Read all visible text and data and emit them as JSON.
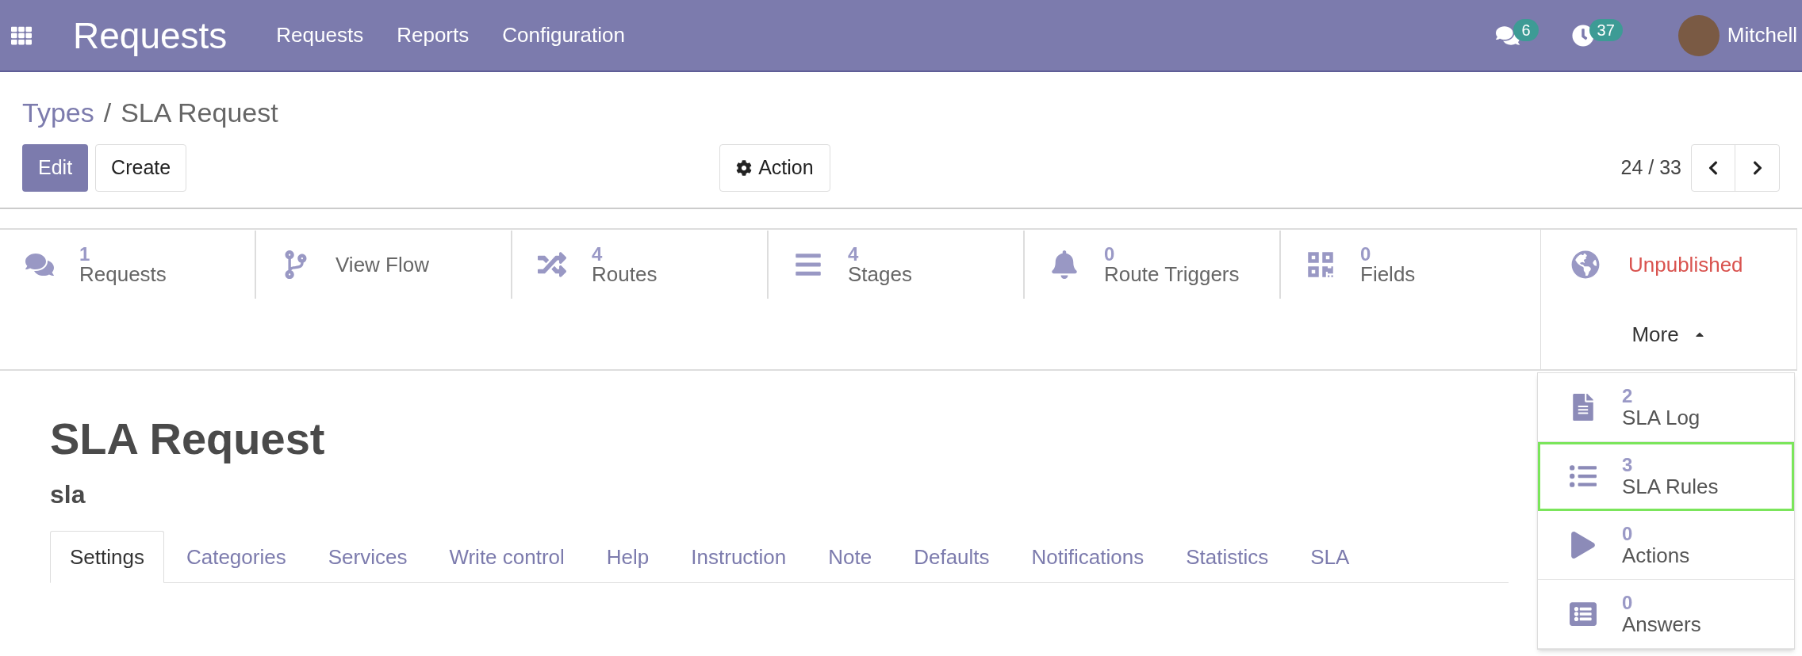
{
  "navbar": {
    "app_title": "Requests",
    "menu": [
      "Requests",
      "Reports",
      "Configuration"
    ],
    "messages_count": "6",
    "activities_count": "37",
    "user_name": "Mitchell"
  },
  "breadcrumb": {
    "parent": "Types",
    "separator": "/",
    "current": "SLA Request"
  },
  "buttons": {
    "edit": "Edit",
    "create": "Create",
    "action": "Action"
  },
  "pager": {
    "value": "24 / 33"
  },
  "smart_buttons": [
    {
      "kind": "stat",
      "count": "1",
      "label": "Requests"
    },
    {
      "kind": "plain",
      "label": "View Flow"
    },
    {
      "kind": "stat",
      "count": "4",
      "label": "Routes"
    },
    {
      "kind": "stat",
      "count": "4",
      "label": "Stages"
    },
    {
      "kind": "stat",
      "count": "0",
      "label": "Route Triggers"
    },
    {
      "kind": "stat",
      "count": "0",
      "label": "Fields"
    }
  ],
  "publish": {
    "label": "Unpublished",
    "published": false
  },
  "more": {
    "label": "More",
    "expanded": true
  },
  "more_menu": [
    {
      "count": "2",
      "label": "SLA Log",
      "highlighted": false
    },
    {
      "count": "3",
      "label": "SLA Rules",
      "highlighted": true
    },
    {
      "count": "0",
      "label": "Actions",
      "highlighted": false
    },
    {
      "count": "0",
      "label": "Answers",
      "highlighted": false
    }
  ],
  "record": {
    "title": "SLA Request",
    "code": "sla"
  },
  "tabs": [
    {
      "label": "Settings",
      "selected": true
    },
    {
      "label": "Categories",
      "selected": false
    },
    {
      "label": "Services",
      "selected": false
    },
    {
      "label": "Write control",
      "selected": false
    },
    {
      "label": "Help",
      "selected": false
    },
    {
      "label": "Instruction",
      "selected": false
    },
    {
      "label": "Note",
      "selected": false
    },
    {
      "label": "Defaults",
      "selected": false
    },
    {
      "label": "Notifications",
      "selected": false
    },
    {
      "label": "Statistics",
      "selected": false
    },
    {
      "label": "SLA",
      "selected": false
    }
  ]
}
